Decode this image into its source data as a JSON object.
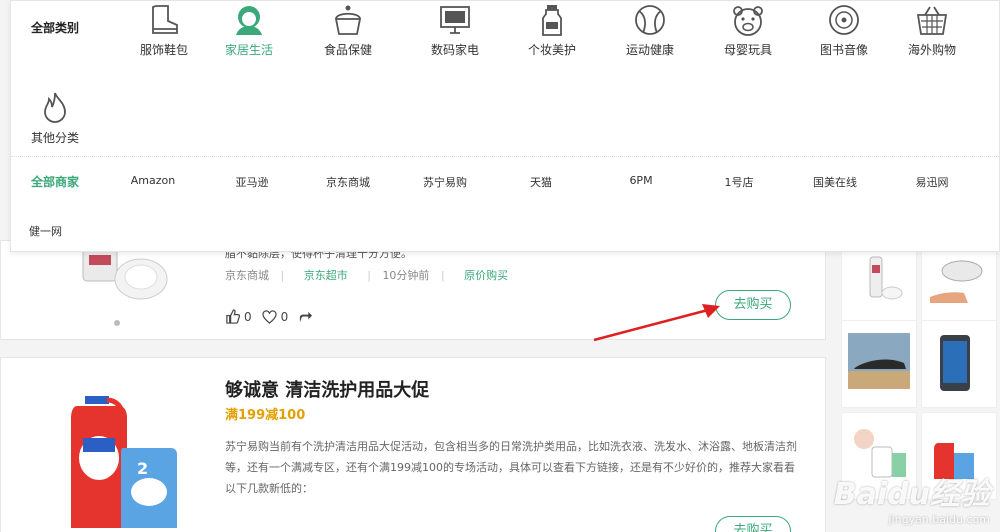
{
  "categories": {
    "all_label": "全部类别",
    "items": [
      {
        "label": "服饰鞋包",
        "icon": "boot-icon"
      },
      {
        "label": "家居生活",
        "icon": "person-icon",
        "active": true
      },
      {
        "label": "食品保健",
        "icon": "cake-icon"
      },
      {
        "label": "数码家电",
        "icon": "monitor-icon"
      },
      {
        "label": "个妆美护",
        "icon": "bottle-icon"
      },
      {
        "label": "运动健康",
        "icon": "ball-icon"
      },
      {
        "label": "母婴玩具",
        "icon": "bear-icon"
      },
      {
        "label": "图书音像",
        "icon": "disc-icon"
      },
      {
        "label": "海外购物",
        "icon": "basket-icon"
      },
      {
        "label": "其他分类",
        "icon": "flame-icon"
      }
    ],
    "accent": "#3aa879"
  },
  "merchants": {
    "all_label": "全部商家",
    "items": [
      "Amazon",
      "亚马逊",
      "京东商城",
      "苏宁易购",
      "天猫",
      "6PM",
      "1号店",
      "国美在线",
      "易迅网",
      "健一网"
    ]
  },
  "card1": {
    "desc": "脂不黏除层，使得杯子清理十分方便。",
    "meta_left": "京东商城",
    "meta_green": "京东超市",
    "meta_mid": "10分钟前",
    "meta_green2": "原价购买",
    "likes": "0",
    "favorites": "0",
    "buy_label": "去购买"
  },
  "card2": {
    "title": "够诚意 清洁洗护用品大促",
    "price": "满199减100",
    "desc": "苏宁易购当前有个洗护清洁用品大促活动，包含相当多的日常洗护类用品，比如洗衣液、洗发水、沐浴露、地板清洁剂等，还有一个满减专区，还有个满199减100的专场活动，具体可以查看下方链接，还是有不少好价的，推荐大家看看以下几款新低的：",
    "buy_label": "去购买"
  },
  "watermark": {
    "line1": "Baidu经验",
    "line2": "jingyan.baidu.com"
  }
}
